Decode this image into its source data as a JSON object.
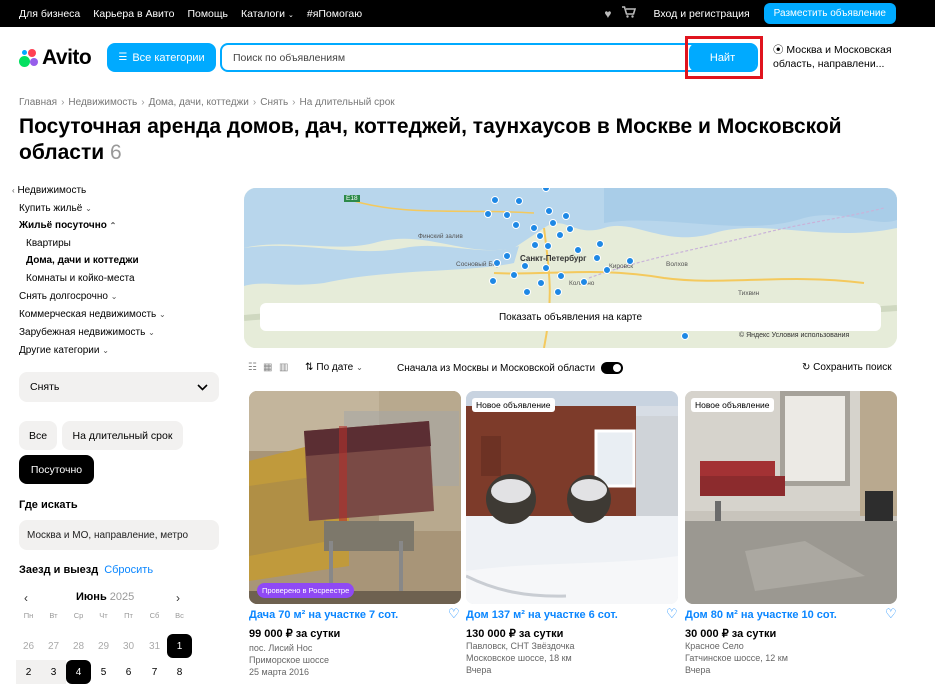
{
  "topbar": {
    "links": [
      "Для бизнеса",
      "Карьера в Авито",
      "Помощь",
      "Каталоги",
      "#яПомогаю"
    ],
    "login": "Вход и регистрация",
    "post_ad": "Разместить объявление"
  },
  "header": {
    "logo": "Avito",
    "categories": "Все категории",
    "search_placeholder": "Поиск по объявлениям",
    "find": "Найт",
    "location": "Москва и Московская область, направлени..."
  },
  "breadcrumb": [
    "Главная",
    "Недвижимость",
    "Дома, дачи, коттеджи",
    "Снять",
    "На длительный срок"
  ],
  "page": {
    "title": "Посуточная аренда домов, дач, коттеджей, таунхаусов в Москве и Московской области",
    "count": "6"
  },
  "sidebar": {
    "back": "Недвижимость",
    "buy": "Купить жильё",
    "daily": "Жильё посуточно",
    "flats": "Квартиры",
    "houses": "Дома, дачи и коттеджи",
    "rooms": "Комнаты и койко-места",
    "long_rent": "Снять долгосрочно",
    "commercial": "Коммерческая недвижимость",
    "foreign": "Зарубежная недвижимость",
    "other": "Другие категории",
    "deal_type": "Снять",
    "pill_all": "Все",
    "pill_long": "На длительный срок",
    "pill_daily": "Посуточно",
    "where_title": "Где искать",
    "where_value": "Москва и МО, направление, метро",
    "dates_title": "Заезд и выезд",
    "reset": "Сбросить",
    "month": "Июнь",
    "year": "2025",
    "weekdays": [
      "Пн",
      "Вт",
      "Ср",
      "Чт",
      "Пт",
      "Сб",
      "Вс"
    ],
    "row1": [
      "26",
      "27",
      "28",
      "29",
      "30",
      "31",
      "1"
    ],
    "row2": [
      "2",
      "3",
      "4",
      "5",
      "6",
      "7",
      "8"
    ]
  },
  "map": {
    "button": "Показать объявления на карте",
    "labels": {
      "city": "Санкт-Петербург",
      "gulf": "Финский залив",
      "kolpino": "Колпино",
      "sosnovy": "Сосновый Бор",
      "volkhov": "Волхов",
      "tikhvin": "Тихвин",
      "kirovsk": "Кировск",
      "road": "E18"
    },
    "attribution": "© Яндекс Условия использования"
  },
  "toolbar": {
    "sort": "По дате",
    "moscow_first": "Сначала из Москвы и Московской области",
    "save_search": "Сохранить поиск"
  },
  "cards": [
    {
      "badge": "Проверено в Росреестре",
      "title": "Дача 70 м² на участке 7 сот.",
      "price": "99 000 ₽ за сутки",
      "line1": "пос. Лисий Нос",
      "line2": "Приморское шоссе",
      "line3": "25 марта 2016"
    },
    {
      "badge": "Новое объявление",
      "title": "Дом 137 м² на участке 6 сот.",
      "price": "130 000 ₽ за сутки",
      "line1": "Павловск, СНТ Звёздочка",
      "line2": "Московское шоссе, 18 км",
      "line3": "Вчера"
    },
    {
      "badge": "Новое объявление",
      "title": "Дом 80 м² на участке 10 сот.",
      "price": "30 000 ₽ за сутки",
      "line1": "Красное Село",
      "line2": "Гатчинское шоссе, 12 км",
      "line3": "Вчера"
    }
  ],
  "colors": {
    "brand": "#00aaff",
    "link": "#0a86ff",
    "highlight": "#e0141e",
    "verified": "#8f49f5"
  }
}
